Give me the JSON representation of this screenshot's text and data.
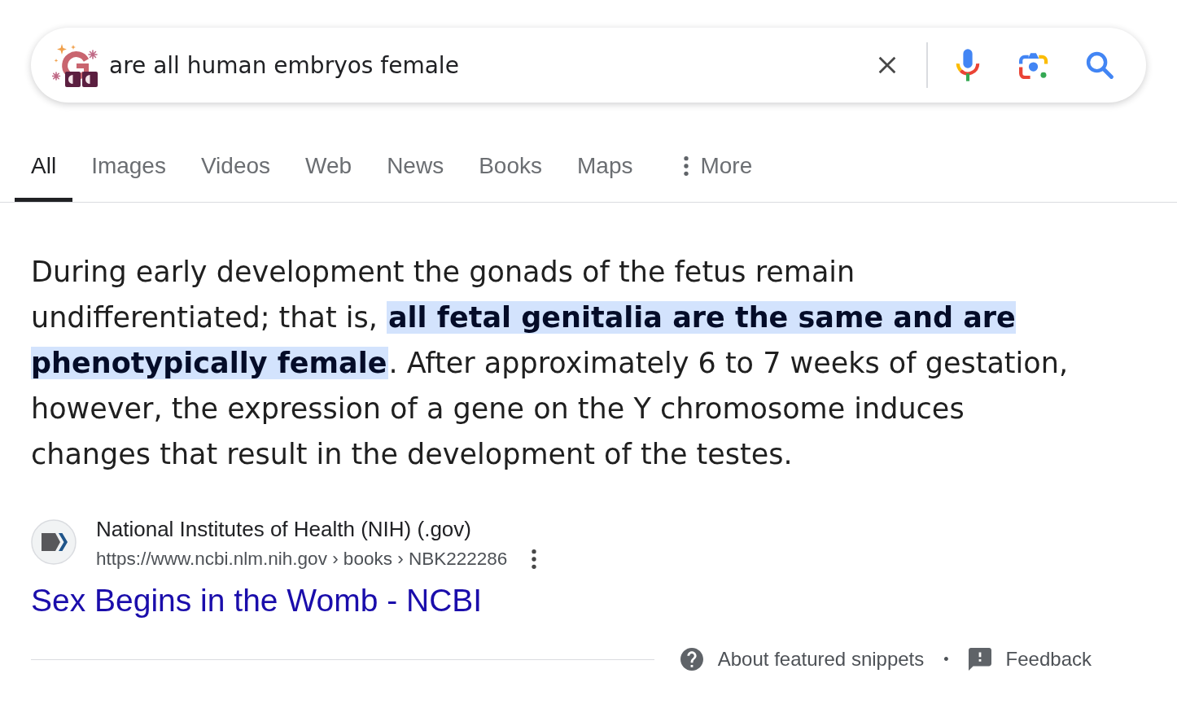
{
  "search": {
    "query": "are all human embryos female"
  },
  "tabs": [
    {
      "label": "All",
      "selected": true,
      "kind": "link"
    },
    {
      "label": "Images",
      "selected": false,
      "kind": "link"
    },
    {
      "label": "Videos",
      "selected": false,
      "kind": "link"
    },
    {
      "label": "Web",
      "selected": false,
      "kind": "link"
    },
    {
      "label": "News",
      "selected": false,
      "kind": "link"
    },
    {
      "label": "Books",
      "selected": false,
      "kind": "link"
    },
    {
      "label": "Maps",
      "selected": false,
      "kind": "link"
    },
    {
      "label": "More",
      "selected": false,
      "kind": "menu"
    }
  ],
  "snippet": {
    "text": "During early development the gonads of the fetus remain undifferentiated; that is, **all fetal genitalia are the same and are phenotypically female**. After approximately 6 to 7 weeks of gestation, however, the expression of a gene on the Y chromosome induces changes that result in the development of the testes."
  },
  "source": {
    "site": "National Institutes of Health (NIH) (.gov)",
    "url": "https://www.ncbi.nlm.nih.gov › books › NBK222286",
    "title": "Sex Begins in the Womb - NCBI"
  },
  "footer": {
    "links": [
      {
        "kind": "help",
        "label": "About featured snippets"
      },
      {
        "kind": "feedback",
        "label": "Feedback"
      }
    ],
    "separator": "•"
  }
}
